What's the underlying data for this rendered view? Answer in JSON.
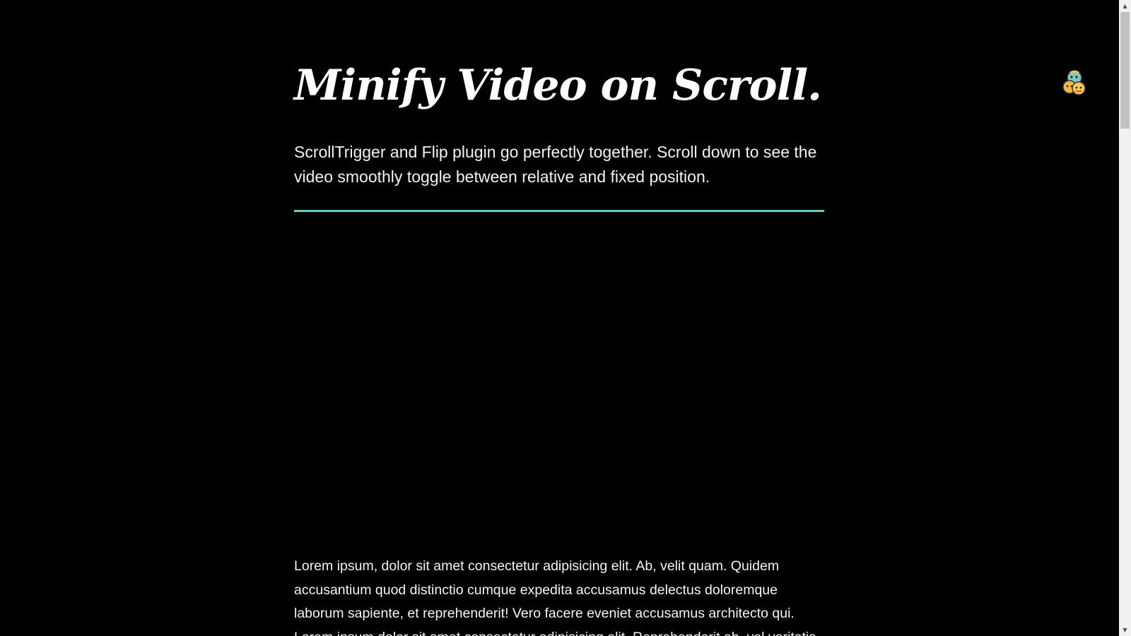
{
  "page": {
    "title": "Minify Video on Scroll.",
    "intro": "ScrollTrigger and Flip plugin go perfectly together. Scroll down to see the video smoothly toggle between relative and fixed position.",
    "body": "Lorem ipsum, dolor sit amet consectetur adipisicing elit. Ab, velit quam. Quidem accusantium quod distinctio cumque expedita accusamus delectus doloremque laborum sapiente, et reprehenderit! Vero facere eveniet accusamus architecto qui. Lorem ipsum dolor sit amet consectetur adipisicing elit. Reprehenderit ab, vel veritatis"
  },
  "colors": {
    "background": "#000000",
    "text": "#ffffff",
    "divider": "#6fcbc2"
  },
  "icons": {
    "avatar": "avatar-icon",
    "scroll_up": "scroll-up-icon",
    "scroll_down": "scroll-down-icon"
  }
}
